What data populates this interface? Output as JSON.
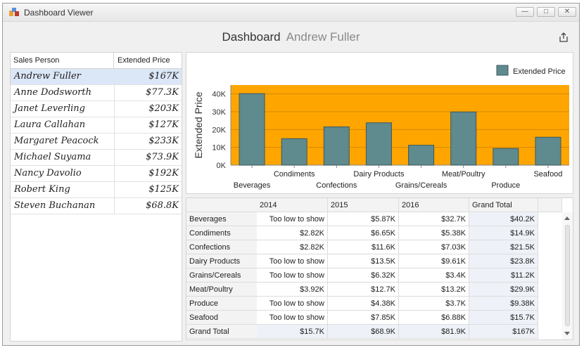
{
  "window": {
    "title": "Dashboard Viewer",
    "min_glyph": "—",
    "max_glyph": "□",
    "close_glyph": "✕"
  },
  "dashboard": {
    "title": "Dashboard",
    "subtitle": "Andrew Fuller"
  },
  "grid": {
    "headers": [
      "Sales Person",
      "Extended Price"
    ],
    "selected_index": 0,
    "rows": [
      {
        "name": "Andrew Fuller",
        "value": "$167K"
      },
      {
        "name": "Anne Dodsworth",
        "value": "$77.3K"
      },
      {
        "name": "Janet Leverling",
        "value": "$203K"
      },
      {
        "name": "Laura Callahan",
        "value": "$127K"
      },
      {
        "name": "Margaret Peacock",
        "value": "$233K"
      },
      {
        "name": "Michael Suyama",
        "value": "$73.9K"
      },
      {
        "name": "Nancy Davolio",
        "value": "$192K"
      },
      {
        "name": "Robert King",
        "value": "$125K"
      },
      {
        "name": "Steven Buchanan",
        "value": "$68.8K"
      }
    ]
  },
  "chart_data": {
    "type": "bar",
    "categories": [
      "Beverages",
      "Condiments",
      "Confections",
      "Dairy Products",
      "Grains/Cereals",
      "Meat/Poultry",
      "Produce",
      "Seafood"
    ],
    "series": [
      {
        "name": "Extended Price",
        "values": [
          40200,
          14900,
          21500,
          23800,
          11200,
          29900,
          9380,
          15700
        ]
      }
    ],
    "ylabel": "Extended Price",
    "yticks": [
      "0K",
      "10K",
      "20K",
      "30K",
      "40K"
    ],
    "ylim": [
      0,
      45000
    ],
    "grid": true,
    "legend": "top-right",
    "plot_bg": "#FFA500",
    "bar_color": "#5F8A8E"
  },
  "pivot": {
    "columns": [
      "2014",
      "2015",
      "2016",
      "Grand Total"
    ],
    "rows": [
      {
        "label": "Beverages",
        "cells": [
          "Too low to show",
          "$5.87K",
          "$32.7K",
          "$40.2K"
        ]
      },
      {
        "label": "Condiments",
        "cells": [
          "$2.82K",
          "$6.65K",
          "$5.38K",
          "$14.9K"
        ]
      },
      {
        "label": "Confections",
        "cells": [
          "$2.82K",
          "$11.6K",
          "$7.03K",
          "$21.5K"
        ]
      },
      {
        "label": "Dairy Products",
        "cells": [
          "Too low to show",
          "$13.5K",
          "$9.61K",
          "$23.8K"
        ]
      },
      {
        "label": "Grains/Cereals",
        "cells": [
          "Too low to show",
          "$6.32K",
          "$3.4K",
          "$11.2K"
        ]
      },
      {
        "label": "Meat/Poultry",
        "cells": [
          "$3.92K",
          "$12.7K",
          "$13.2K",
          "$29.9K"
        ]
      },
      {
        "label": "Produce",
        "cells": [
          "Too low to show",
          "$4.38K",
          "$3.7K",
          "$9.38K"
        ]
      },
      {
        "label": "Seafood",
        "cells": [
          "Too low to show",
          "$7.85K",
          "$6.88K",
          "$15.7K"
        ]
      }
    ],
    "total_row": {
      "label": "Grand Total",
      "cells": [
        "$15.7K",
        "$68.9K",
        "$81.9K",
        "$167K"
      ]
    }
  }
}
